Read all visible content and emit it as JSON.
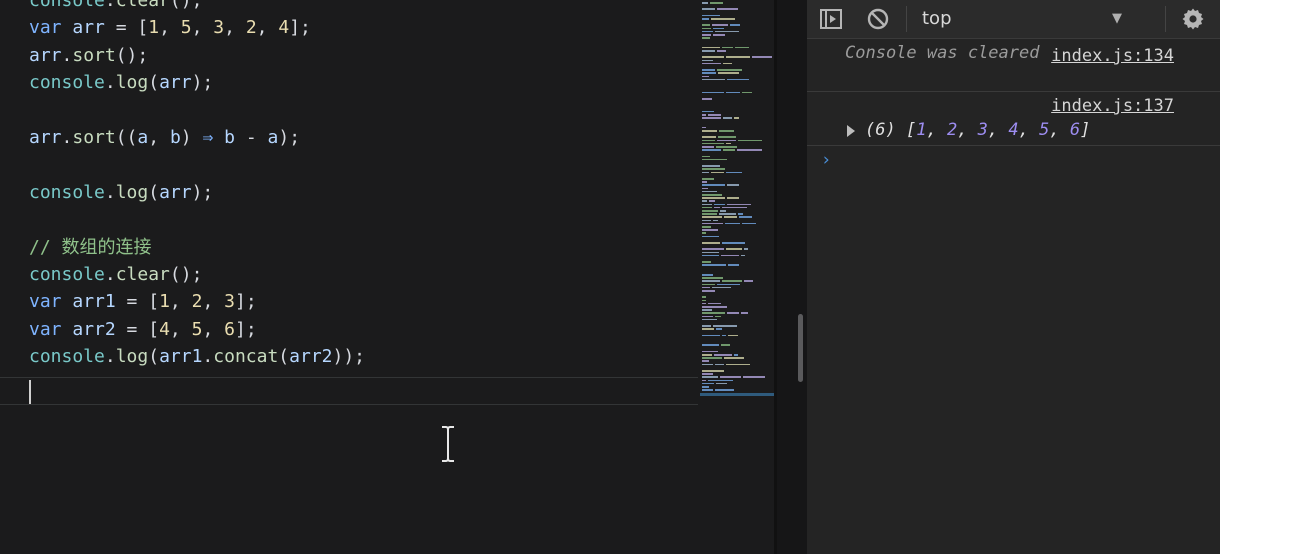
{
  "editor": {
    "lines": [
      [
        {
          "t": "console",
          "c": "obj"
        },
        {
          "t": ".",
          "c": "pl"
        },
        {
          "t": "clear",
          "c": "fn"
        },
        {
          "t": "();",
          "c": "pl"
        }
      ],
      [
        {
          "t": "var ",
          "c": "kw"
        },
        {
          "t": "arr",
          "c": "id"
        },
        {
          "t": " = [",
          "c": "pl"
        },
        {
          "t": "1",
          "c": "num"
        },
        {
          "t": ", ",
          "c": "pl"
        },
        {
          "t": "5",
          "c": "num"
        },
        {
          "t": ", ",
          "c": "pl"
        },
        {
          "t": "3",
          "c": "num"
        },
        {
          "t": ", ",
          "c": "pl"
        },
        {
          "t": "2",
          "c": "num"
        },
        {
          "t": ", ",
          "c": "pl"
        },
        {
          "t": "4",
          "c": "num"
        },
        {
          "t": "];",
          "c": "pl"
        }
      ],
      [
        {
          "t": "arr",
          "c": "id"
        },
        {
          "t": ".",
          "c": "pl"
        },
        {
          "t": "sort",
          "c": "fn"
        },
        {
          "t": "();",
          "c": "pl"
        }
      ],
      [
        {
          "t": "console",
          "c": "obj"
        },
        {
          "t": ".",
          "c": "pl"
        },
        {
          "t": "log",
          "c": "fn"
        },
        {
          "t": "(",
          "c": "pl"
        },
        {
          "t": "arr",
          "c": "id"
        },
        {
          "t": ");",
          "c": "pl"
        }
      ],
      [],
      [
        {
          "t": "arr",
          "c": "id"
        },
        {
          "t": ".",
          "c": "pl"
        },
        {
          "t": "sort",
          "c": "fn"
        },
        {
          "t": "((",
          "c": "pl"
        },
        {
          "t": "a",
          "c": "id"
        },
        {
          "t": ", ",
          "c": "pl"
        },
        {
          "t": "b",
          "c": "id"
        },
        {
          "t": ") ",
          "c": "pl"
        },
        {
          "t": "⇒",
          "c": "kw"
        },
        {
          "t": " b ",
          "c": "id"
        },
        {
          "t": "- ",
          "c": "pl"
        },
        {
          "t": "a",
          "c": "id"
        },
        {
          "t": ");",
          "c": "pl"
        }
      ],
      [],
      [
        {
          "t": "console",
          "c": "obj"
        },
        {
          "t": ".",
          "c": "pl"
        },
        {
          "t": "log",
          "c": "fn"
        },
        {
          "t": "(",
          "c": "pl"
        },
        {
          "t": "arr",
          "c": "id"
        },
        {
          "t": ");",
          "c": "pl"
        }
      ],
      [],
      [
        {
          "t": "// 数组的连接",
          "c": "cm"
        }
      ],
      [
        {
          "t": "console",
          "c": "obj"
        },
        {
          "t": ".",
          "c": "pl"
        },
        {
          "t": "clear",
          "c": "fn"
        },
        {
          "t": "();",
          "c": "pl"
        }
      ],
      [
        {
          "t": "var ",
          "c": "kw"
        },
        {
          "t": "arr1",
          "c": "id"
        },
        {
          "t": " = [",
          "c": "pl"
        },
        {
          "t": "1",
          "c": "num"
        },
        {
          "t": ", ",
          "c": "pl"
        },
        {
          "t": "2",
          "c": "num"
        },
        {
          "t": ", ",
          "c": "pl"
        },
        {
          "t": "3",
          "c": "num"
        },
        {
          "t": "];",
          "c": "pl"
        }
      ],
      [
        {
          "t": "var ",
          "c": "kw"
        },
        {
          "t": "arr2",
          "c": "id"
        },
        {
          "t": " = [",
          "c": "pl"
        },
        {
          "t": "4",
          "c": "num"
        },
        {
          "t": ", ",
          "c": "pl"
        },
        {
          "t": "5",
          "c": "num"
        },
        {
          "t": ", ",
          "c": "pl"
        },
        {
          "t": "6",
          "c": "num"
        },
        {
          "t": "];",
          "c": "pl"
        }
      ],
      [
        {
          "t": "console",
          "c": "obj"
        },
        {
          "t": ".",
          "c": "pl"
        },
        {
          "t": "log",
          "c": "fn"
        },
        {
          "t": "(",
          "c": "pl"
        },
        {
          "t": "arr1",
          "c": "id"
        },
        {
          "t": ".",
          "c": "pl"
        },
        {
          "t": "concat",
          "c": "fn"
        },
        {
          "t": "(",
          "c": "pl"
        },
        {
          "t": "arr2",
          "c": "id"
        },
        {
          "t": "));",
          "c": "pl"
        }
      ]
    ]
  },
  "console": {
    "context": "top",
    "icons": [
      "sidebar-toggle-icon",
      "clear-console-icon",
      "dropdown-caret-icon",
      "gear-icon"
    ],
    "messages": {
      "cleared": {
        "text": "Console was cleared",
        "source": "index.js:134"
      },
      "output": {
        "source": "index.js:137",
        "count": "(6)",
        "values": [
          "1",
          "2",
          "3",
          "4",
          "5",
          "6"
        ]
      }
    },
    "prompt": "›"
  },
  "colors": {
    "editor_bg": "#1b1b1c",
    "console_bg": "#242424",
    "number_accent": "#9d8df1"
  }
}
